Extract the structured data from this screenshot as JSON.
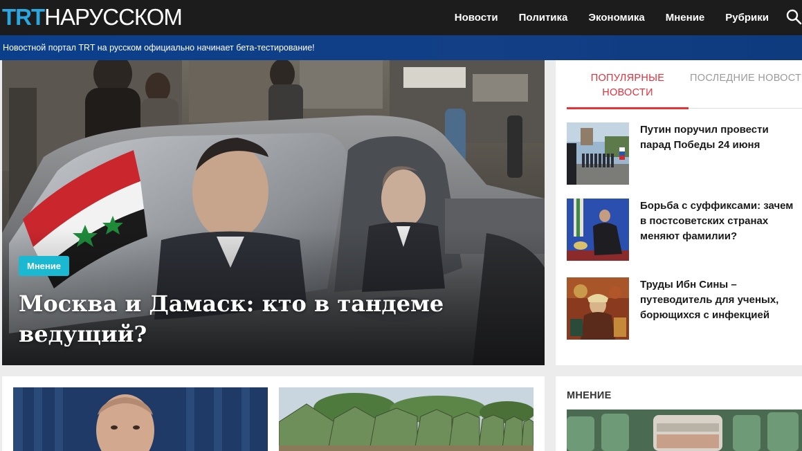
{
  "header": {
    "logo_trt": "TRT",
    "logo_rest": "НАРУССКОМ",
    "nav": [
      "Новости",
      "Политика",
      "Экономика",
      "Мнение",
      "Рубрики"
    ]
  },
  "announcement": "Новостной портал TRT на русском официально начинает бета-тестирование!",
  "hero": {
    "tag": "Мнение",
    "title": "Москва и Дамаск: кто в тандеме ведущий?"
  },
  "sidebar": {
    "tabs": {
      "popular": "ПОПУЛЯРНЫЕ НОВОСТИ",
      "latest": "ПОСЛЕДНИЕ НОВОСТИ"
    },
    "items": [
      {
        "title": "Путин поручил провести парад Победы 24 июня"
      },
      {
        "title": "Борьба с суффиксами: зачем в постсоветских странах меняют фамилии?"
      },
      {
        "title": "Труды Ибн Сины – путеводитель для ученых, борющихся с инфекцией"
      }
    ]
  },
  "opinion": {
    "label": "МНЕНИЕ"
  },
  "colors": {
    "accent_red": "#e6303a",
    "brand_blue": "#2aa6e0",
    "tag_cyan": "#1bb8d2",
    "header_bg": "#1c1c1c",
    "announce_bg": "#0b3f8c"
  }
}
